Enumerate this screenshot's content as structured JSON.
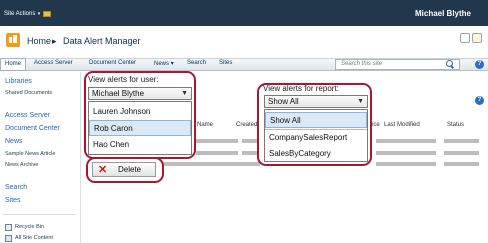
{
  "ribbon": {
    "site_actions": "Site Actions",
    "user_name": "Michael Blythe"
  },
  "title_area": {
    "breadcrumb_home": "Home",
    "breadcrumb_separator": "▸",
    "page_title": "Data Alert Manager"
  },
  "top_nav": {
    "items": [
      "Home",
      "Access Server",
      "Document Center",
      "News",
      "Search",
      "Sites"
    ],
    "news_caret": "▾",
    "search_placeholder": "Search this site"
  },
  "quick_launch": {
    "items": [
      {
        "label": "Libraries",
        "kind": "head"
      },
      {
        "label": "Shared Documents",
        "kind": "sub"
      },
      {
        "label": "Access Server",
        "kind": "head"
      },
      {
        "label": "Document Center",
        "kind": "head"
      },
      {
        "label": "News",
        "kind": "head"
      },
      {
        "label": "Sample News Article",
        "kind": "sub"
      },
      {
        "label": "News Archive",
        "kind": "sub"
      },
      {
        "label": "Search",
        "kind": "head"
      },
      {
        "label": "Sites",
        "kind": "head"
      }
    ],
    "recycle_bin": "Recycle Bin",
    "all_site_content": "All Site Content"
  },
  "grid": {
    "columns": [
      "Name",
      "Created",
      "nce",
      "Last Modified",
      "Status"
    ]
  },
  "user_panel": {
    "label": "View alerts for user:",
    "selected": "Michael Blythe",
    "options": [
      "Lauren Johnson",
      "Rob Caron",
      "Hao Chen"
    ],
    "highlighted_option": "Rob Caron"
  },
  "report_panel": {
    "label": "View alerts for report:",
    "selected": "Show All",
    "options": [
      "Show All",
      "CompanySalesReport",
      "SalesByCategory"
    ],
    "highlighted_option": "Show All"
  },
  "delete_button": {
    "label": "Delete",
    "icon": "✕"
  },
  "icons": {
    "help": "?",
    "dropdown_arrow": "▼"
  },
  "colors": {
    "ribbon_bg": "#21374c",
    "callout_border": "#a71930",
    "link_blue": "#0e4a8a",
    "delete_x": "#c21b17",
    "highlight": "#dbe9f7"
  }
}
